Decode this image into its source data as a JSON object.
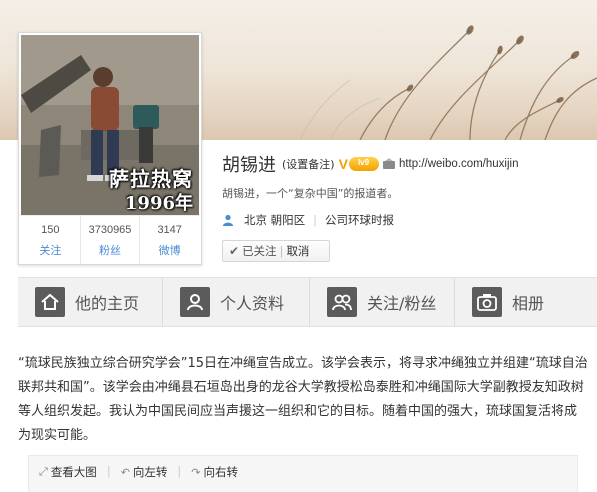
{
  "profile": {
    "name": "胡锡进",
    "remark_link": "(设置备注)",
    "verified_label": "V",
    "vip_label": "lv9",
    "url": "http://weibo.com/huxijin",
    "bio": "胡锡进，一个“复杂中国”的报道者。",
    "location": "北京 朝阳区",
    "company": "公司环球时报",
    "follow_status": "已关注",
    "unfollow_label": "取消",
    "photo_caption": "萨拉热窝",
    "photo_year": "1996年"
  },
  "stats": [
    {
      "value": "150",
      "label": "关注"
    },
    {
      "value": "3730965",
      "label": "粉丝"
    },
    {
      "value": "3147",
      "label": "微博"
    }
  ],
  "tabs": [
    {
      "label": "他的主页",
      "icon": "home-icon"
    },
    {
      "label": "个人资料",
      "icon": "profile-icon"
    },
    {
      "label": "关注/粉丝",
      "icon": "fans-icon"
    },
    {
      "label": "相册",
      "icon": "camera-icon"
    }
  ],
  "post": {
    "text": "“琉球民族独立综合研究学会”15日在冲绳宣告成立。该学会表示，将寻求冲绳独立并组建“琉球自治联邦共和国”。该学会由冲绳县石垣岛出身的龙谷大学教授松岛泰胜和冲绳国际大学副教授友知政树等人组织发起。我认为中国民间应当声援这一组织和它的目标。随着中国的强大，琉球国复活将成为现实可能。",
    "tools": [
      "查看大图",
      "向左转",
      "向右转"
    ]
  },
  "colors": {
    "link_blue": "#4a8bd5",
    "verified_orange": "#f0a000",
    "tab_bg": "#f1f1f1",
    "tab_icon_bg": "#5b5b5b"
  }
}
